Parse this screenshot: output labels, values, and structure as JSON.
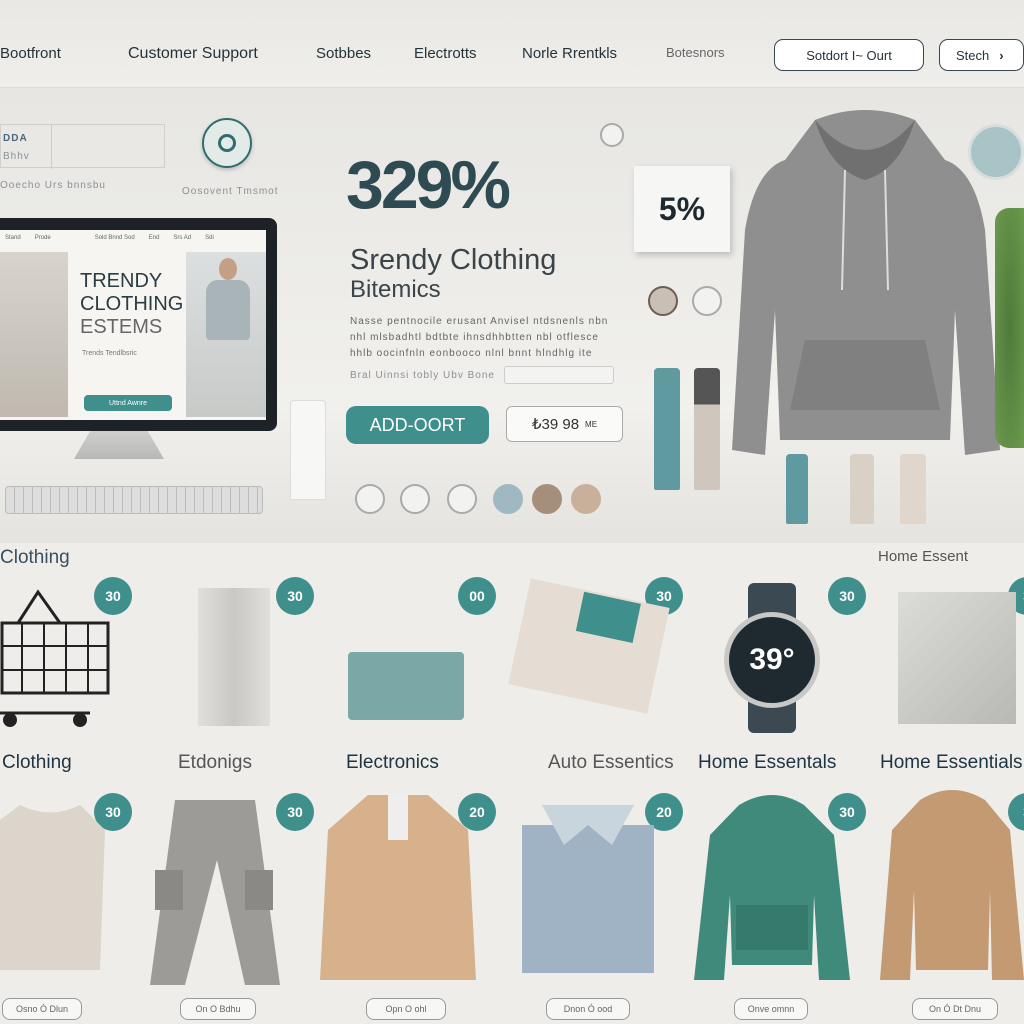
{
  "nav": {
    "links": [
      "Bootfront",
      "Customer Support",
      "Sotbbes",
      "Electrotts",
      "Norle Rrentkls",
      "Botesnors"
    ],
    "cart_button": "Sotdort I~ Ourt",
    "search_button": "Stech",
    "search_arrow_icon": "chevron-right-icon"
  },
  "hero": {
    "info_card": {
      "line1": "DDA",
      "line2": "Bhhv",
      "line3": "Ooecho  Urs bnnsbu"
    },
    "logo_caption": "Oosovent Tmsmot",
    "screen": {
      "nav_items": [
        "Stand",
        "Prode",
        "Sold Bnnd Sod",
        "End",
        "Srs Ad",
        "Sdi"
      ],
      "title_line1": "TRENDY",
      "title_line2": "CLOTHING",
      "title_line3": "ESTEMS",
      "caption": "Trends Tendlbsric",
      "cta": "Uttnd Awnre"
    },
    "discount": "329%",
    "headline_line1": "Srendy  Clothing",
    "headline_line2": "Bitemics",
    "description": "Nasse pentnocile erusant Anvisel ntdsnenls nbn nhl mlsbadhtl bdtbte ihnsdhhbtten nbl otflesce hhlb oocinfnln eonbooco nlnl bnnt hlndhlg ite",
    "qty_label": "Bral Uinnsi tobly  Ubv Bone",
    "add_button": "ADD-OORT",
    "price": "₺39 98",
    "price_suffix": "ME",
    "box_discount": "5%"
  },
  "categories_top": {
    "left_label": "Clothing",
    "right_label": "Home Essent",
    "badges": [
      "30",
      "30",
      "00",
      "30",
      "30",
      "3"
    ],
    "watch_display": "39°"
  },
  "categories": [
    "Clothing",
    "Etdonigs",
    "Electronics",
    "Auto Essentics",
    "Home Essentals",
    "Home Essentials"
  ],
  "products": {
    "badges": [
      "30",
      "30",
      "20",
      "20",
      "30",
      "3"
    ],
    "buttons": [
      "Osno Ó Dlun",
      "On O Bdhu",
      "Opn O ohl",
      "Dnon Ó ood",
      "Onve omnn",
      "On Ó Dt Dnu"
    ]
  },
  "colors": {
    "accent": "#3f8f8c",
    "text": "#25333a",
    "background": "#eeede9"
  }
}
